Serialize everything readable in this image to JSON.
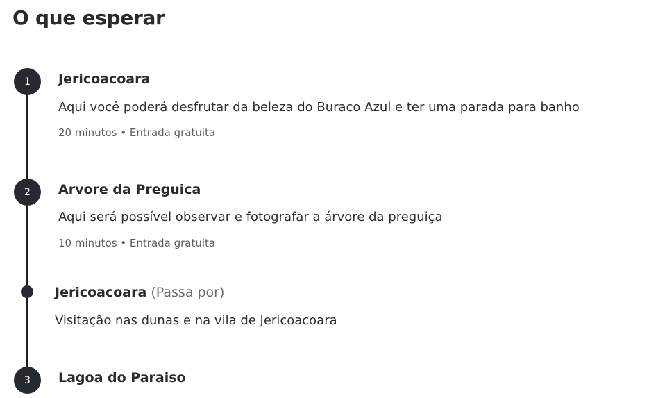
{
  "header": {
    "title": "O que esperar"
  },
  "itinerary": {
    "stop1": {
      "number": "1",
      "title": "Jericoacoara",
      "description": "Aqui você poderá desfrutar da beleza do Buraco Azul e ter uma parada para banho",
      "meta": "20 minutos • Entrada gratuita"
    },
    "stop2": {
      "number": "2",
      "title": "Arvore da Preguica",
      "description": "Aqui será possível observar e fotografar a árvore da preguiça",
      "meta": "10 minutos • Entrada gratuita"
    },
    "pass_by": {
      "title": "Jericoacoara",
      "tag": "(Passa por)",
      "description": "Visitação nas dunas e na vila de Jericoacoara"
    },
    "stop3": {
      "number": "3",
      "title": "Lagoa do Paraiso"
    }
  },
  "colors": {
    "marker": "#262a30",
    "line": "#1e1e1e",
    "text": "#2b2b2b",
    "muted": "#5e5e5e"
  }
}
